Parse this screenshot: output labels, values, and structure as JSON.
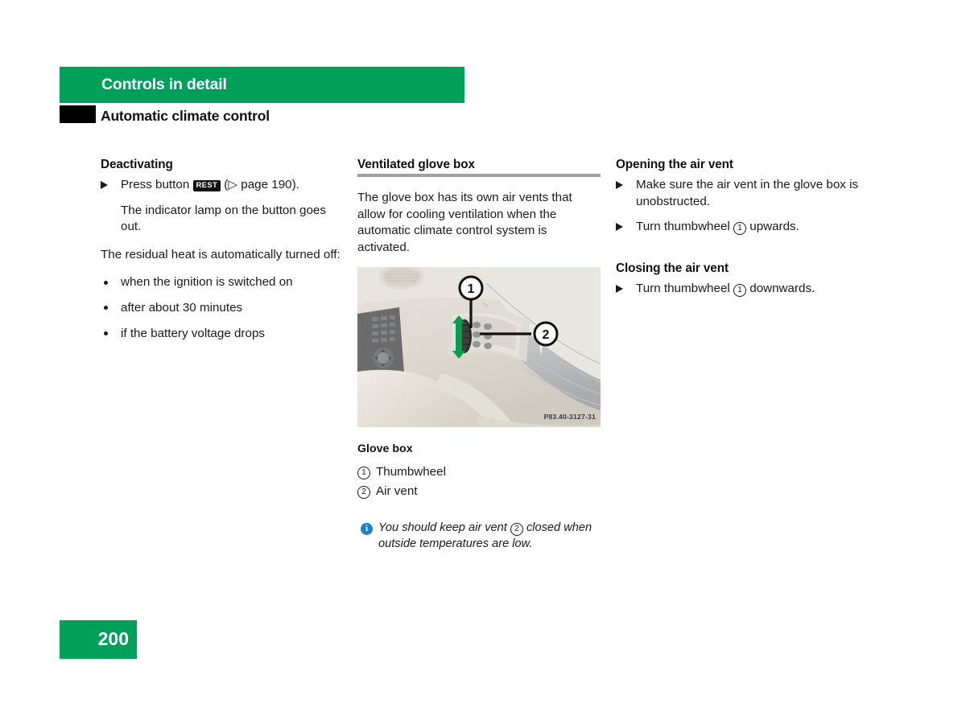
{
  "header": {
    "chapter": "Controls in detail",
    "section": "Automatic climate control"
  },
  "left_column": {
    "heading": "Deactivating",
    "action_1_before": "Press button",
    "action_1_key": "REST",
    "action_1_after": "(▷ page 190).",
    "action_1_page_ref": "page 190",
    "action_1_note": "The indicator lamp on the button goes out.",
    "paragraph": "The residual heat is automatically turned off:",
    "bullets": [
      "when the ignition is switched on",
      "after about 30 minutes",
      "if the battery voltage drops"
    ]
  },
  "middle_column": {
    "heading": "Ventilated glove box",
    "paragraph": "The glove box has its own air vents that allow for cooling ventilation when the automatic climate control system is activated.",
    "photo": {
      "alt": "Glove box interior showing thumbwheel and air vent",
      "code": "P83.40-3127-31",
      "callout_1": "1",
      "callout_2": "2"
    },
    "caption_title": "Glove box",
    "legend": [
      {
        "num": "1",
        "label": "Thumbwheel"
      },
      {
        "num": "2",
        "label": "Air vent"
      }
    ],
    "note": {
      "icon": "info-icon",
      "text_before": "You should keep air vent",
      "ref_num": "2",
      "text_after": "closed when outside temperatures are low."
    }
  },
  "right_column": {
    "heading_open": "Opening the air vent",
    "open_action_1": "Make sure the air vent in the glove box is unobstructed.",
    "open_action_2_before": "Turn thumbwheel",
    "open_action_2_num": "1",
    "open_action_2_after": "upwards.",
    "heading_close": "Closing the air vent",
    "close_action_before": "Turn thumbwheel",
    "close_action_num": "1",
    "close_action_after": "downwards."
  },
  "footer": {
    "page_number": "200"
  },
  "colors": {
    "brand_green": "#00a05b",
    "info_blue": "#1b84c8",
    "rule_gray": "#a0a0a0",
    "key_black": "#111111"
  }
}
